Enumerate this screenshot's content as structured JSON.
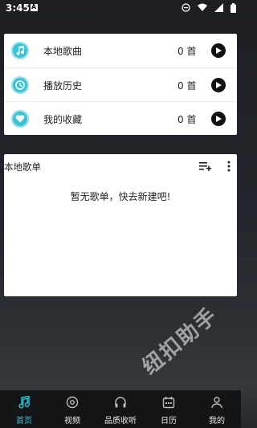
{
  "status_bar": {
    "time": "3:45",
    "notification_letter": "A",
    "icons": [
      "do-not-disturb-icon",
      "wifi-icon",
      "signal-icon",
      "battery-icon"
    ]
  },
  "quick_list": [
    {
      "label": "本地歌曲",
      "count": "0 首",
      "icon": "music-note-icon"
    },
    {
      "label": "播放历史",
      "count": "0 首",
      "icon": "clock-icon"
    },
    {
      "label": "我的收藏",
      "count": "0 首",
      "icon": "heart-icon"
    }
  ],
  "playlist": {
    "title": "本地歌单",
    "empty_text": "暂无歌单，快去新建吧!",
    "actions": [
      "add-playlist-icon",
      "more-vertical-icon"
    ]
  },
  "watermark": "纽扣助手",
  "bottom_nav": [
    {
      "label": "首页",
      "icon": "music-note-icon",
      "active": true
    },
    {
      "label": "视频",
      "icon": "video-icon",
      "active": false
    },
    {
      "label": "品质收听",
      "icon": "headphones-icon",
      "active": false
    },
    {
      "label": "日历",
      "icon": "calendar-icon",
      "active": false
    },
    {
      "label": "我的",
      "icon": "profile-icon",
      "active": false
    }
  ],
  "colors": {
    "accent": "#2fc5d8",
    "icon_fill": "#3cc3d3",
    "nav_bg": "#141516"
  }
}
